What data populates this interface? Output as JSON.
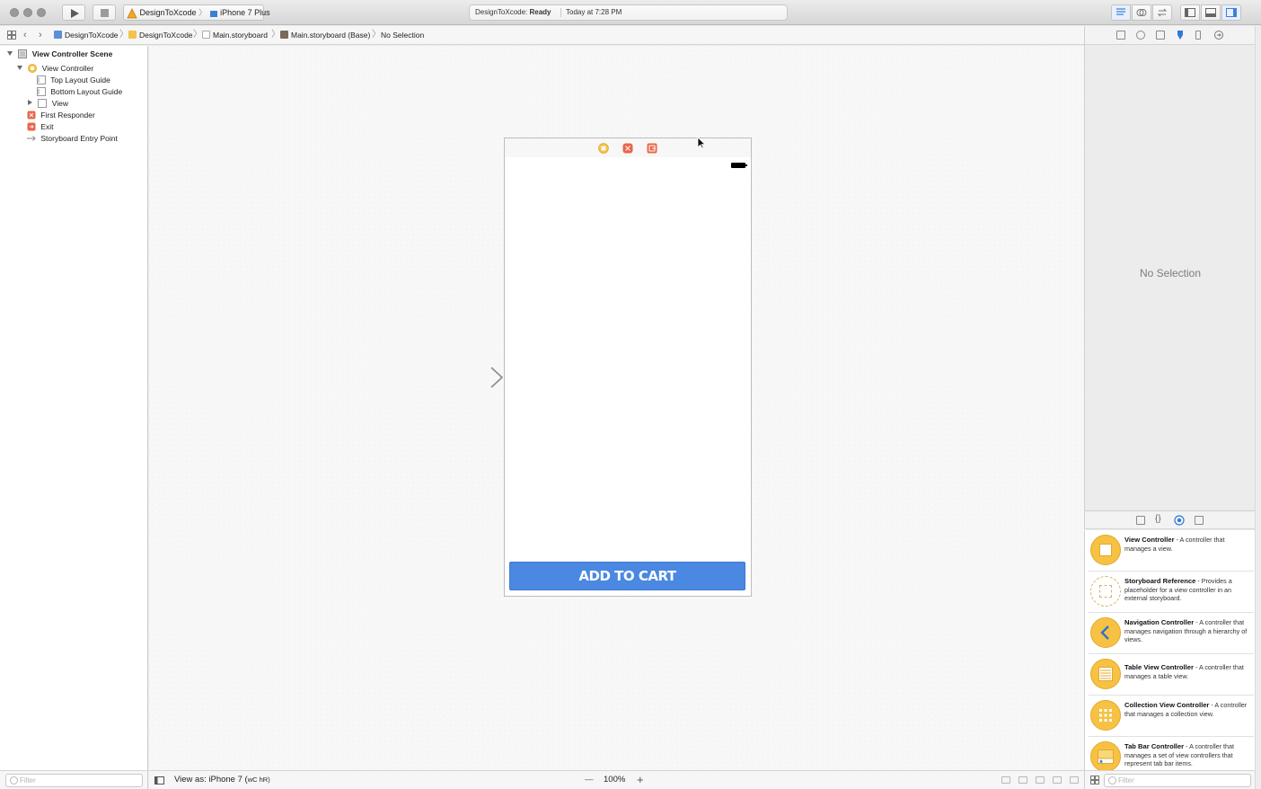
{
  "toolbar": {
    "scheme_target": "DesignToXcode",
    "scheme_device": "iPhone 7 Plus",
    "activity_project": "DesignToXcode: ",
    "activity_status": "Ready",
    "activity_time": "Today at 7:28 PM"
  },
  "jumpbar": {
    "items": [
      "DesignToXcode",
      "DesignToXcode",
      "Main.storyboard",
      "Main.storyboard (Base)",
      "No Selection"
    ]
  },
  "navigator": {
    "rows": [
      {
        "label": "View Controller Scene",
        "icon": "scene-icon"
      },
      {
        "label": "View Controller",
        "icon": "view-controller-icon"
      },
      {
        "label": "Top Layout Guide",
        "icon": "layout-guide-icon"
      },
      {
        "label": "Bottom Layout Guide",
        "icon": "layout-guide-icon"
      },
      {
        "label": "View",
        "icon": "view-icon"
      },
      {
        "label": "First Responder",
        "icon": "first-responder-icon"
      },
      {
        "label": "Exit",
        "icon": "exit-icon"
      },
      {
        "label": "Storyboard Entry Point",
        "icon": "entry-point-arrow-icon"
      }
    ],
    "filter_placeholder": "Filter"
  },
  "canvas": {
    "button_label": "ADD TO CART",
    "view_as": "View as: iPhone 7 (",
    "view_as_suffix": "wC hR)",
    "zoom": "100%",
    "zoom_out": "—",
    "zoom_in": "+"
  },
  "inspector": {
    "empty_label": "No Selection"
  },
  "library": {
    "items": [
      {
        "title": "View Controller",
        "desc": " - A controller that manages a view."
      },
      {
        "title": "Storyboard Reference",
        "desc": " - Provides a placeholder for a view controller in an external storyboard."
      },
      {
        "title": "Navigation Controller",
        "desc": " - A controller that manages navigation through a hierarchy of views."
      },
      {
        "title": "Table View Controller",
        "desc": " - A controller that manages a table view."
      },
      {
        "title": "Collection View Controller",
        "desc": " - A controller that manages a collection view."
      },
      {
        "title": "Tab Bar Controller",
        "desc": " - A controller that manages a set of view controllers that represent tab bar items."
      }
    ],
    "filter_placeholder": "Filter"
  },
  "colors": {
    "button_blue": "#4a88e1",
    "controller_yellow": "#f7c243",
    "responder_orange": "#e8674a"
  }
}
